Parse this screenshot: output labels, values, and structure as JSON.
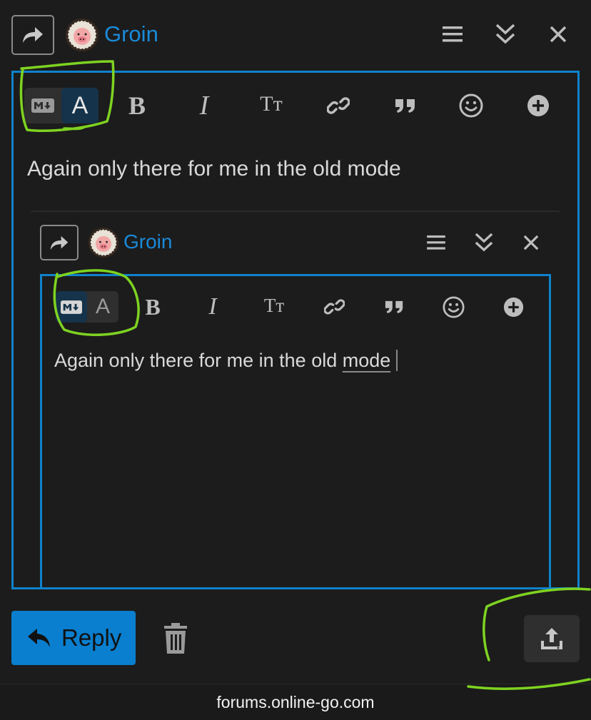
{
  "outer": {
    "username": "Groin",
    "message_text": "Again only there for me in the old mode"
  },
  "inner": {
    "username": "Groin",
    "message_text_before": "Again only there for me in the old ",
    "message_text_underlined": "mode"
  },
  "toolbar": {
    "markdown_label": "M↓",
    "richtext_label": "A",
    "bold_label": "B",
    "italic_label": "I",
    "heading_label": "Tт"
  },
  "actions": {
    "reply_label": "Reply"
  },
  "footer": {
    "domain": "forums.online-go.com"
  },
  "colors": {
    "accent": "#0f82cc",
    "username": "#1a8ad8",
    "reply_bg": "#0a7fcf",
    "annotation": "#7ed321",
    "background": "#1c1c1c"
  },
  "icons": [
    "share-icon",
    "avatar-pig-icon",
    "list-icon",
    "chevrons-down-icon",
    "close-icon",
    "link-icon",
    "quote-icon",
    "emoji-icon",
    "plus-circle-icon",
    "reply-arrow-icon",
    "trash-icon",
    "upload-icon"
  ]
}
